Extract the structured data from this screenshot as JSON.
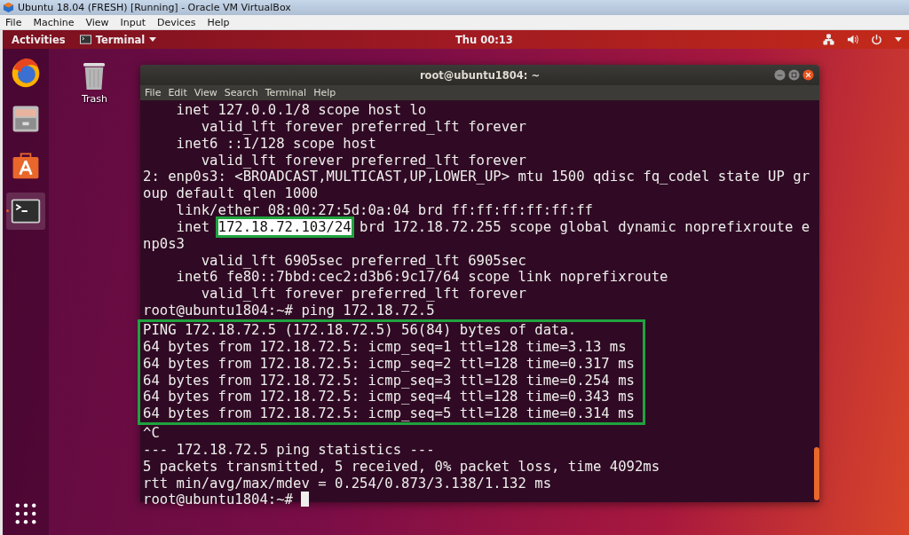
{
  "host_window": {
    "title": "Ubuntu 18.04 (FRESH) [Running] - Oracle VM VirtualBox",
    "menu": [
      "File",
      "Machine",
      "View",
      "Input",
      "Devices",
      "Help"
    ]
  },
  "top_bar": {
    "activities": "Activities",
    "app_menu": "Terminal",
    "clock": "Thu 00:13"
  },
  "dock": {
    "items": [
      {
        "kind": "browser",
        "selected": false,
        "running": false
      },
      {
        "kind": "files",
        "selected": false,
        "running": false
      },
      {
        "kind": "software",
        "selected": false,
        "running": false
      },
      {
        "kind": "terminal",
        "selected": true,
        "running": true
      }
    ]
  },
  "desktop_icons": [
    {
      "kind": "trash",
      "label": "Trash"
    }
  ],
  "terminal": {
    "title": "root@ubuntu1804: ~",
    "menu": [
      "File",
      "Edit",
      "View",
      "Search",
      "Terminal",
      "Help"
    ],
    "blocks": [
      {
        "boxed": false,
        "lines": [
          {
            "text": "    inet 127.0.0.1/8 scope host lo"
          },
          {
            "text": "       valid_lft forever preferred_lft forever"
          },
          {
            "text": "    inet6 ::1/128 scope host"
          },
          {
            "text": "       valid_lft forever preferred_lft forever"
          },
          {
            "text": "2: enp0s3: <BROADCAST,MULTICAST,UP,LOWER_UP> mtu 1500 qdisc fq_codel state UP gr"
          },
          {
            "text": "oup default qlen 1000"
          },
          {
            "text": "    link/ether 08:00:27:5d:0a:04 brd ff:ff:ff:ff:ff:ff"
          },
          {
            "parts": [
              {
                "text": "    inet ",
                "highlighted": false
              },
              {
                "text": "172.18.72.103/24",
                "highlighted": true
              },
              {
                "text": " brd 172.18.72.255 scope global dynamic noprefixroute e",
                "highlighted": false
              }
            ]
          },
          {
            "text": "np0s3"
          },
          {
            "text": "       valid_lft 6905sec preferred_lft 6905sec"
          },
          {
            "text": "    inet6 fe80::7bbd:cec2:d3b6:9c17/64 scope link noprefixroute"
          },
          {
            "text": "       valid_lft forever preferred_lft forever"
          },
          {
            "text": "root@ubuntu1804:~# ping 172.18.72.5"
          }
        ]
      },
      {
        "boxed": true,
        "lines": [
          {
            "text": "PING 172.18.72.5 (172.18.72.5) 56(84) bytes of data."
          },
          {
            "text": "64 bytes from 172.18.72.5: icmp_seq=1 ttl=128 time=3.13 ms"
          },
          {
            "text": "64 bytes from 172.18.72.5: icmp_seq=2 ttl=128 time=0.317 ms"
          },
          {
            "text": "64 bytes from 172.18.72.5: icmp_seq=3 ttl=128 time=0.254 ms"
          },
          {
            "text": "64 bytes from 172.18.72.5: icmp_seq=4 ttl=128 time=0.343 ms"
          },
          {
            "text": "64 bytes from 172.18.72.5: icmp_seq=5 ttl=128 time=0.314 ms"
          }
        ]
      },
      {
        "boxed": false,
        "lines": [
          {
            "text": "^C"
          },
          {
            "text": "--- 172.18.72.5 ping statistics ---"
          },
          {
            "text": "5 packets transmitted, 5 received, 0% packet loss, time 4092ms"
          },
          {
            "text": "rtt min/avg/max/mdev = 0.254/0.873/3.138/1.132 ms"
          },
          {
            "text": "root@ubuntu1804:~# ",
            "cursor": true
          }
        ]
      }
    ]
  }
}
